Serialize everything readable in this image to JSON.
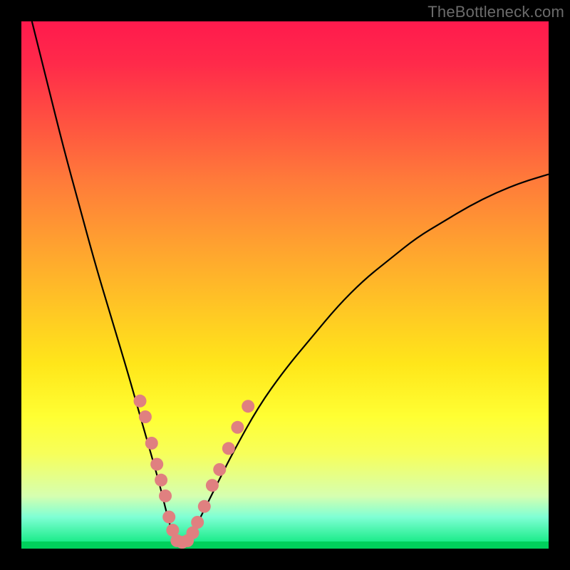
{
  "watermark": "TheBottleneck.com",
  "colors": {
    "dot": "#e08080",
    "curve": "#000000",
    "frame": "#000000"
  },
  "chart_data": {
    "type": "line",
    "title": "",
    "xlabel": "",
    "ylabel": "",
    "xlim": [
      0,
      100
    ],
    "ylim": [
      0,
      100
    ],
    "grid": false,
    "legend": false,
    "series": [
      {
        "name": "bottleneck-curve",
        "x": [
          2,
          5,
          8,
          11,
          14,
          17,
          20,
          22,
          24,
          26,
          27,
          28,
          29,
          30,
          32,
          34,
          37,
          40,
          45,
          50,
          55,
          60,
          65,
          70,
          75,
          80,
          85,
          90,
          95,
          100
        ],
        "y": [
          100,
          88,
          76,
          65,
          54,
          44,
          34,
          27,
          20,
          13,
          9,
          5,
          2,
          1,
          2,
          6,
          12,
          18,
          27,
          34,
          40,
          46,
          51,
          55,
          59,
          62,
          65,
          67.5,
          69.5,
          71
        ]
      }
    ],
    "points": [
      {
        "x": 22.5,
        "y": 28
      },
      {
        "x": 23.5,
        "y": 25
      },
      {
        "x": 24.7,
        "y": 20
      },
      {
        "x": 25.7,
        "y": 16
      },
      {
        "x": 26.5,
        "y": 13
      },
      {
        "x": 27.3,
        "y": 10
      },
      {
        "x": 28.0,
        "y": 6
      },
      {
        "x": 28.7,
        "y": 3.5
      },
      {
        "x": 29.5,
        "y": 1.5
      },
      {
        "x": 30.5,
        "y": 1.2
      },
      {
        "x": 31.5,
        "y": 1.5
      },
      {
        "x": 32.5,
        "y": 3
      },
      {
        "x": 33.4,
        "y": 5
      },
      {
        "x": 34.7,
        "y": 8
      },
      {
        "x": 36.2,
        "y": 12
      },
      {
        "x": 37.6,
        "y": 15
      },
      {
        "x": 39.3,
        "y": 19
      },
      {
        "x": 41.0,
        "y": 23
      },
      {
        "x": 43.0,
        "y": 27
      }
    ]
  }
}
